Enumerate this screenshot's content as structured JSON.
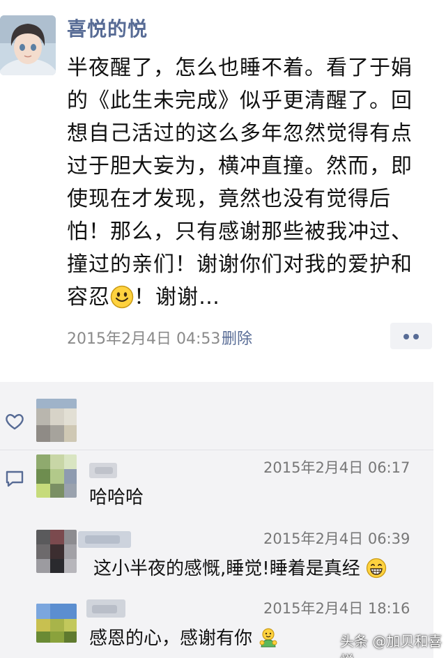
{
  "post": {
    "author": "喜悦的悦",
    "avatar_icon": "profile-avatar",
    "body": "半夜醒了，怎么也睡不着。看了于娟\n的《此生未完成》似乎更清醒了。回\n想自己活过的这么多年忽然觉得有点\n过于胆大妄为，横冲直撞。然而，即\n使现在才发现，竟然也没有觉得后\n怕！那么，只有感谢那些被我冲过、\n撞过的亲们！谢谢你们对我的爱护和\n容忍",
    "body_end": "！谢谢…",
    "timestamp": "2015年2月4日 04:53",
    "delete_label": "删除",
    "more_icon": "more-dots-icon"
  },
  "likes": {
    "icon": "heart-icon"
  },
  "comments": [
    {
      "time": "2015年2月4日 06:17",
      "text": "哈哈哈"
    },
    {
      "time": "2015年2月4日 06:39",
      "text": "这小半夜的感慨,睡觉!睡着是真经"
    },
    {
      "time": "2015年2月4日 18:16",
      "text": "感恩的心，感谢有你"
    }
  ],
  "comment_icon": "comment-icon",
  "watermark": "头条 @加贝和喜悦"
}
